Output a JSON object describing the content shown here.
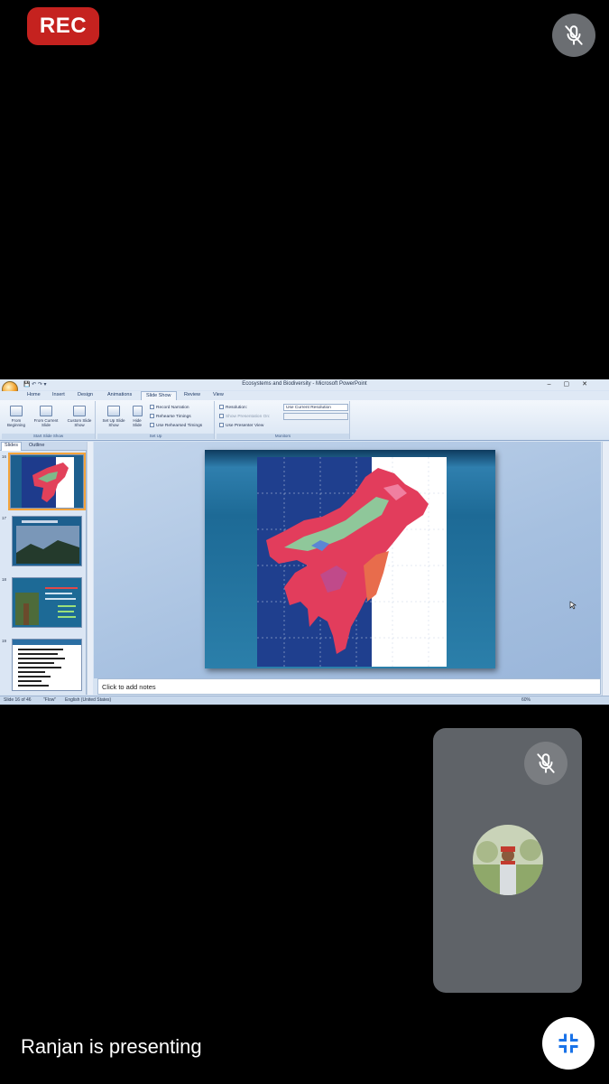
{
  "meeting": {
    "rec_label": "REC",
    "presenting_text": "Ranjan is presenting"
  },
  "icons": {
    "top_right": "mic-off-icon",
    "tile": "mic-off-icon",
    "bottom_right": "minimize-screen-icon"
  },
  "colors": {
    "rec": "#c5221f",
    "tile": "#5f6368",
    "mic_button": "#6b6e72"
  },
  "powerpoint": {
    "window_title": "Ecosystems and Biodiversity - Microsoft PowerPoint",
    "tabs": [
      "Home",
      "Insert",
      "Design",
      "Animations",
      "Slide Show",
      "Review",
      "View"
    ],
    "active_tab": "Slide Show",
    "ribbon": {
      "start_group": {
        "caption": "Start Slide Show",
        "from_beginning": "From Beginning",
        "from_current": "From Current Slide",
        "custom": "Custom Slide Show"
      },
      "setup_group": {
        "caption": "Set Up",
        "setup_show": "Set Up Slide Show",
        "hide_slide": "Hide Slide",
        "record_narration": "Record Narration",
        "rehearse_timings": "Rehearse Timings",
        "use_rehearsed": "Use Rehearsed Timings"
      },
      "monitors_group": {
        "caption": "Monitors",
        "resolution_label": "Resolution:",
        "resolution_value": "Use Current Resolution",
        "show_presentation_on": "Show Presentation On:",
        "use_presenter_view": "Use Presenter View"
      }
    },
    "pane_tabs": [
      "Slides",
      "Outline"
    ],
    "thumbnails": [
      "16",
      "17",
      "18",
      "19"
    ],
    "notes_placeholder": "Click to add notes",
    "status": {
      "slide": "Slide 16 of 46",
      "theme": "\"Flow\"",
      "language": "English (United States)",
      "zoom": "60%"
    }
  }
}
